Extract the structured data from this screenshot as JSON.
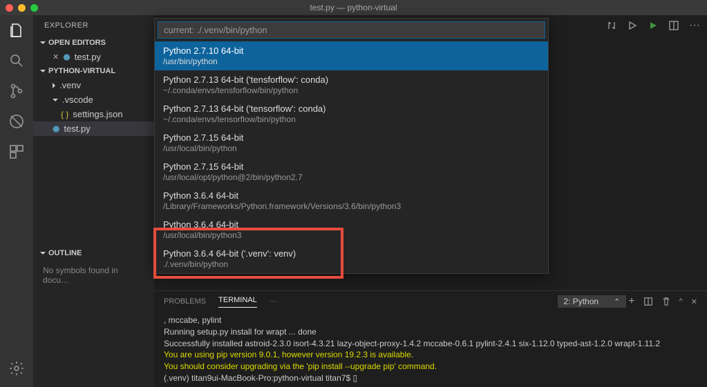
{
  "window": {
    "title": "test.py — python-virtual"
  },
  "sidebar": {
    "header": "EXPLORER",
    "open_editors": {
      "label": "OPEN EDITORS",
      "items": [
        {
          "name": "test.py",
          "icon": "file"
        }
      ]
    },
    "workspace": {
      "label": "PYTHON-VIRTUAL",
      "items": [
        {
          "name": ".venv",
          "type": "folder",
          "expanded": false
        },
        {
          "name": ".vscode",
          "type": "folder",
          "expanded": true,
          "children": [
            {
              "name": "settings.json",
              "icon": "json"
            }
          ]
        },
        {
          "name": "test.py",
          "type": "file",
          "icon": "file",
          "selected": true
        }
      ]
    },
    "outline": {
      "label": "OUTLINE",
      "empty_text": "No symbols found in docu…"
    }
  },
  "quickpick": {
    "placeholder": "current: ./.venv/bin/python",
    "items": [
      {
        "title": "Python 2.7.10 64-bit",
        "path": "/usr/bin/python",
        "selected": true
      },
      {
        "title": "Python 2.7.13 64-bit ('tensforflow': conda)",
        "path": "~/.conda/envs/tensforflow/bin/python"
      },
      {
        "title": "Python 2.7.13 64-bit ('tensorflow': conda)",
        "path": "~/.conda/envs/tensorflow/bin/python"
      },
      {
        "title": "Python 2.7.15 64-bit",
        "path": "/usr/local/bin/python"
      },
      {
        "title": "Python 2.7.15 64-bit",
        "path": "/usr/local/opt/python@2/bin/python2.7"
      },
      {
        "title": "Python 3.6.4 64-bit",
        "path": "/Library/Frameworks/Python.framework/Versions/3.6/bin/python3"
      },
      {
        "title": "Python 3.6.4 64-bit",
        "path": "/usr/local/bin/python3"
      },
      {
        "title": "Python 3.6.4 64-bit ('.venv': venv)",
        "path": "./.venv/bin/python"
      }
    ]
  },
  "panel": {
    "tabs": {
      "problems": "PROBLEMS",
      "terminal": "TERMINAL",
      "more": "···"
    },
    "terminal_name": "2: Python",
    "lines": [
      {
        "cls": "term-white",
        "text": ", mccabe, pylint"
      },
      {
        "cls": "term-white",
        "text": "  Running setup.py install for wrapt ... done"
      },
      {
        "cls": "term-white",
        "text": "Successfully installed astroid-2.3.0 isort-4.3.21 lazy-object-proxy-1.4.2 mccabe-0.6.1 pylint-2.4.1 six-1.12.0 typed-ast-1.2.0 wrapt-1.11.2"
      },
      {
        "cls": "term-yellow",
        "text": "You are using pip version 9.0.1, however version 19.2.3 is available."
      },
      {
        "cls": "term-yellow",
        "text": "You should consider upgrading via the 'pip install --upgrade pip' command."
      },
      {
        "cls": "term-white",
        "text": "(.venv) titan9ui-MacBook-Pro:python-virtual titan7$ ▯"
      }
    ]
  },
  "annotation": {
    "target_index": 7
  }
}
